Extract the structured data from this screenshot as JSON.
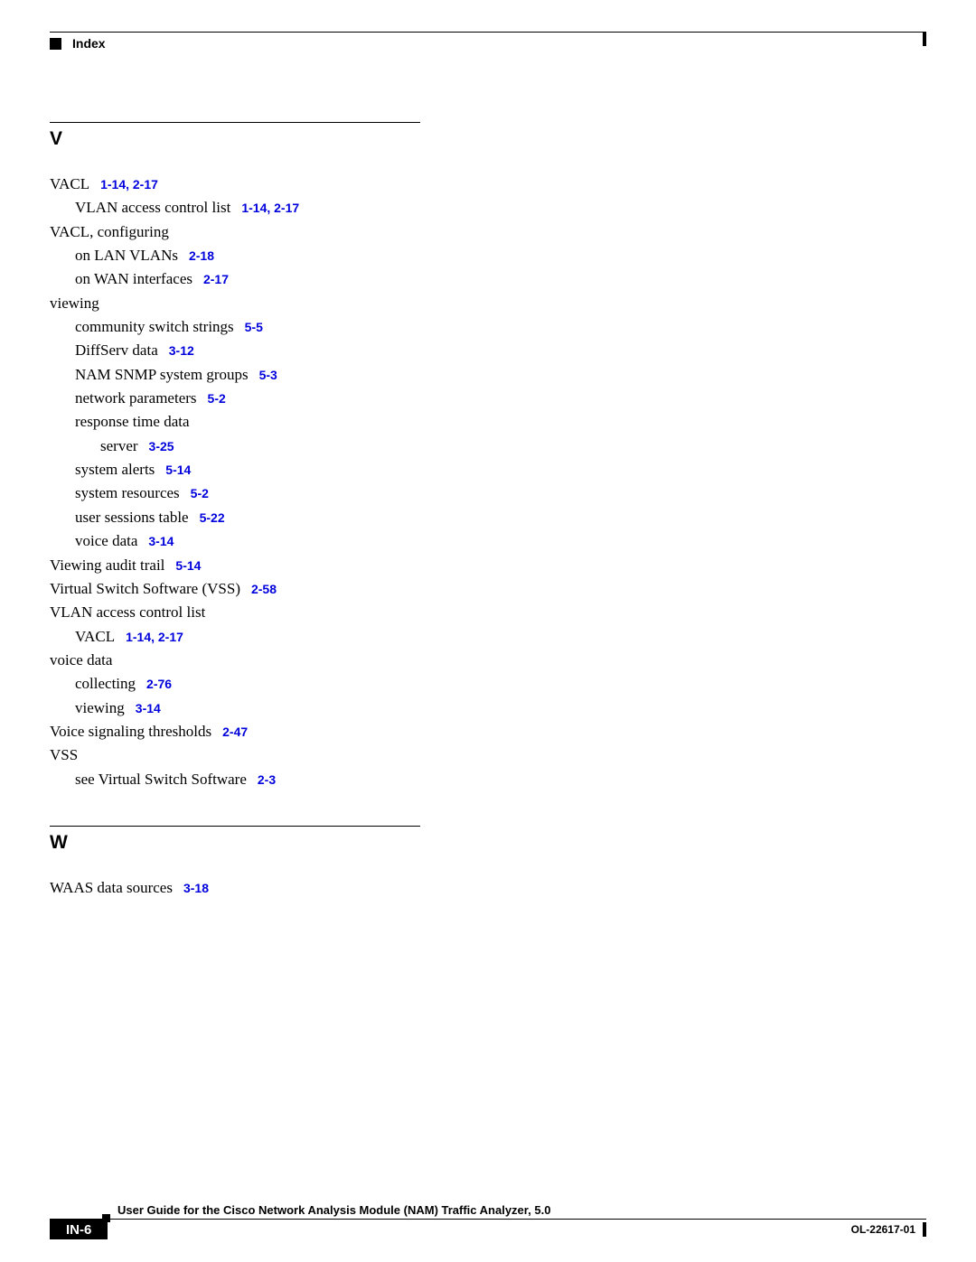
{
  "header": {
    "label": "Index"
  },
  "sections": {
    "V": {
      "letter": "V",
      "entries": {
        "vacl": {
          "text": "VACL",
          "refs": "1-14, 2-17"
        },
        "vacl_vlan": {
          "text": "VLAN access control list",
          "refs": "1-14, 2-17"
        },
        "vacl_conf": {
          "text": "VACL, configuring"
        },
        "vacl_conf_lan": {
          "text": "on LAN VLANs",
          "refs": "2-18"
        },
        "vacl_conf_wan": {
          "text": "on WAN interfaces",
          "refs": "2-17"
        },
        "viewing": {
          "text": "viewing"
        },
        "view_css": {
          "text": "community switch strings",
          "refs": "5-5"
        },
        "view_diffserv": {
          "text": "DiffServ data",
          "refs": "3-12"
        },
        "view_nam": {
          "text": "NAM SNMP system groups",
          "refs": "5-3"
        },
        "view_net": {
          "text": "network parameters",
          "refs": "5-2"
        },
        "view_resp": {
          "text": "response time data"
        },
        "view_resp_server": {
          "text": "server",
          "refs": "3-25"
        },
        "view_alerts": {
          "text": "system alerts",
          "refs": "5-14"
        },
        "view_resources": {
          "text": "system resources",
          "refs": "5-2"
        },
        "view_sessions": {
          "text": "user sessions table",
          "refs": "5-22"
        },
        "view_voice": {
          "text": "voice data",
          "refs": "3-14"
        },
        "audit": {
          "text": "Viewing audit trail",
          "refs": "5-14"
        },
        "vss": {
          "text": "Virtual Switch Software (VSS)",
          "refs": "2-58"
        },
        "vlan_acl": {
          "text": "VLAN access control list"
        },
        "vlan_acl_vacl": {
          "text": "VACL",
          "refs": "1-14, 2-17"
        },
        "voice_data": {
          "text": "voice data"
        },
        "voice_collect": {
          "text": "collecting",
          "refs": "2-76"
        },
        "voice_view": {
          "text": "viewing",
          "refs": "3-14"
        },
        "voice_sig": {
          "text": "Voice signaling thresholds",
          "refs": "2-47"
        },
        "vss2": {
          "text": "VSS"
        },
        "vss2_see": {
          "text": "see Virtual Switch Software",
          "refs": "2-3"
        }
      }
    },
    "W": {
      "letter": "W",
      "entries": {
        "waas": {
          "text": "WAAS data sources",
          "refs": "3-18"
        }
      }
    }
  },
  "footer": {
    "title": "User Guide for the Cisco Network Analysis Module (NAM) Traffic Analyzer, 5.0",
    "page": "IN-6",
    "doc": "OL-22617-01"
  }
}
